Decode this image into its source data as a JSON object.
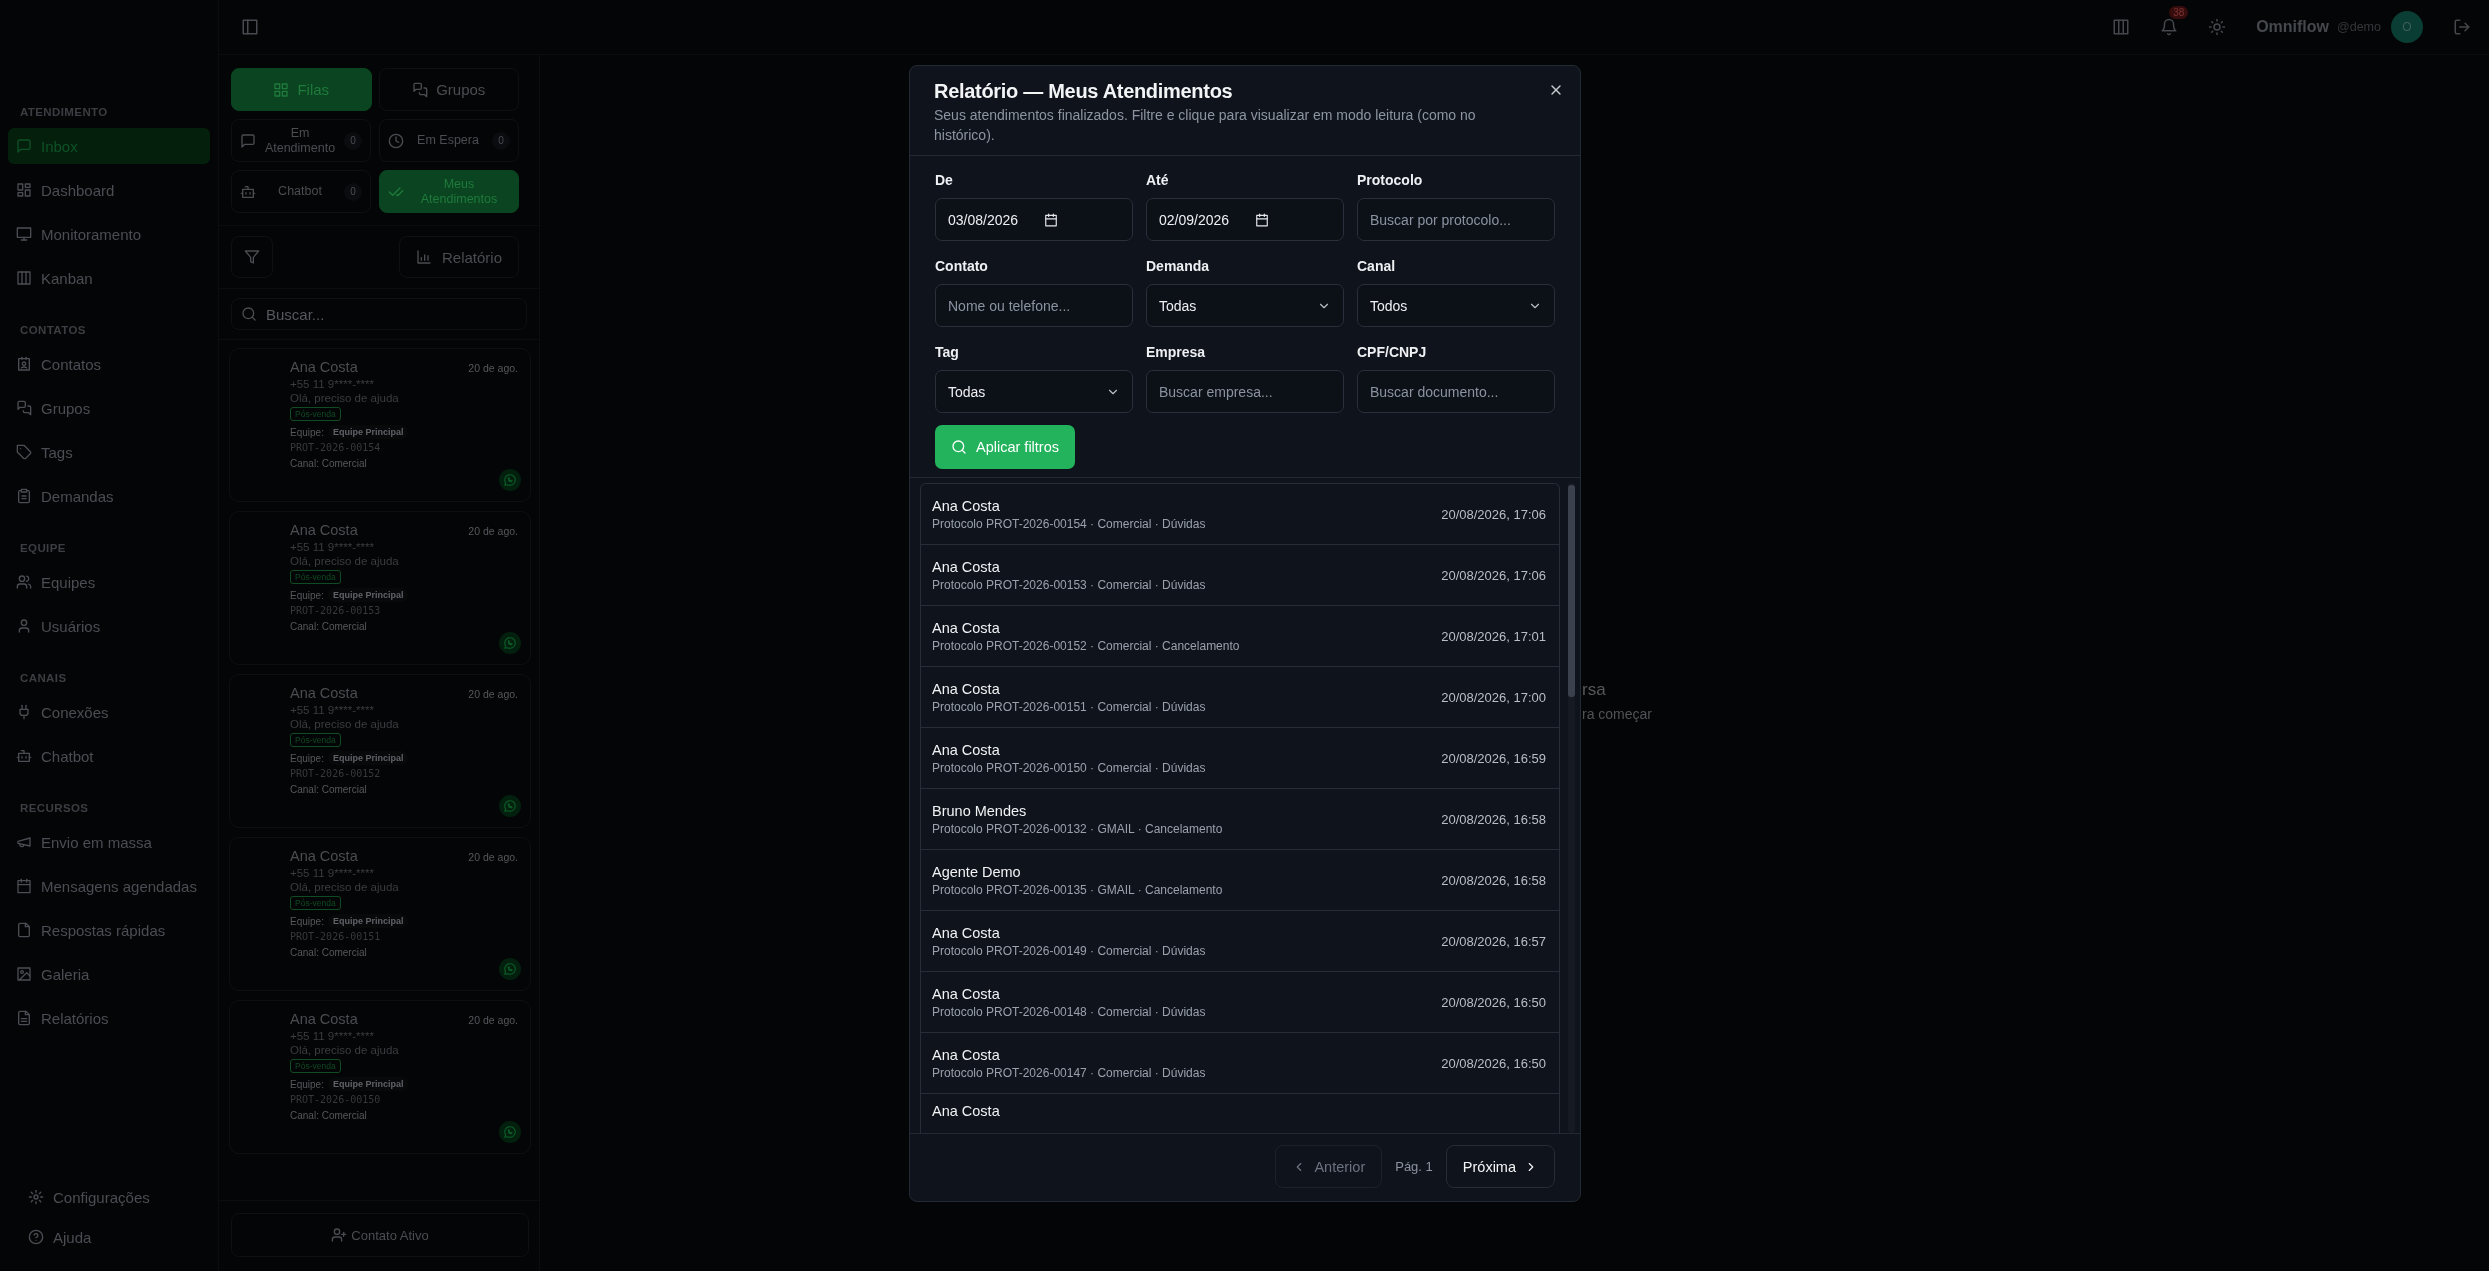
{
  "sidebar": {
    "sections": [
      {
        "title": "ATENDIMENTO",
        "items": [
          {
            "label": "Inbox",
            "selected": true
          },
          {
            "label": "Dashboard",
            "selected": false
          },
          {
            "label": "Monitoramento",
            "selected": false
          },
          {
            "label": "Kanban",
            "selected": false
          }
        ]
      },
      {
        "title": "CONTATOS",
        "items": [
          {
            "label": "Contatos",
            "selected": false
          },
          {
            "label": "Grupos",
            "selected": false
          },
          {
            "label": "Tags",
            "selected": false
          },
          {
            "label": "Demandas",
            "selected": false
          }
        ]
      },
      {
        "title": "EQUIPE",
        "items": [
          {
            "label": "Equipes",
            "selected": false
          },
          {
            "label": "Usuários",
            "selected": false
          }
        ]
      },
      {
        "title": "CANAIS",
        "items": [
          {
            "label": "Conexões",
            "selected": false
          },
          {
            "label": "Chatbot",
            "selected": false
          }
        ]
      },
      {
        "title": "RECURSOS",
        "items": [
          {
            "label": "Envio em massa",
            "selected": false
          },
          {
            "label": "Mensagens agendadas",
            "selected": false
          },
          {
            "label": "Respostas rápidas",
            "selected": false
          },
          {
            "label": "Galeria",
            "selected": false
          },
          {
            "label": "Relatórios",
            "selected": false
          }
        ]
      }
    ],
    "footer_items": [
      "Configurações",
      "Ajuda"
    ]
  },
  "header": {
    "notification_count": "38",
    "brand": "Omniflow",
    "username": "@demo",
    "avatar_initial": "O"
  },
  "inbox": {
    "tabs": [
      {
        "label": "Filas",
        "selected": true
      },
      {
        "label": "Grupos",
        "selected": false
      }
    ],
    "queues": [
      {
        "label": "Em Atendimento",
        "count": "0",
        "selected": false
      },
      {
        "label": "Em Espera",
        "count": "0",
        "selected": false
      },
      {
        "label": "Chatbot",
        "count": "0",
        "selected": false
      },
      {
        "label": "Meus Atendimentos",
        "selected": true
      }
    ],
    "report_button": "Relatório",
    "search": {
      "placeholder": "Buscar..."
    },
    "cards": [
      {
        "name": "Ana Costa",
        "date": "20 de ago.",
        "phone": "+55 11 9****-****",
        "message": "Olá, preciso de ajuda",
        "tag": "Pós-venda",
        "team_label": "Equipe:",
        "team": "Equipe Principal",
        "protocol": "PROT-2026-00154",
        "channel": "Canal: Comercial"
      },
      {
        "name": "Ana Costa",
        "date": "20 de ago.",
        "phone": "+55 11 9****-****",
        "message": "Olá, preciso de ajuda",
        "tag": "Pós-venda",
        "team_label": "Equipe:",
        "team": "Equipe Principal",
        "protocol": "PROT-2026-00153",
        "channel": "Canal: Comercial"
      },
      {
        "name": "Ana Costa",
        "date": "20 de ago.",
        "phone": "+55 11 9****-****",
        "message": "Olá, preciso de ajuda",
        "tag": "Pós-venda",
        "team_label": "Equipe:",
        "team": "Equipe Principal",
        "protocol": "PROT-2026-00152",
        "channel": "Canal: Comercial"
      },
      {
        "name": "Ana Costa",
        "date": "20 de ago.",
        "phone": "+55 11 9****-****",
        "message": "Olá, preciso de ajuda",
        "tag": "Pós-venda",
        "team_label": "Equipe:",
        "team": "Equipe Principal",
        "protocol": "PROT-2026-00151",
        "channel": "Canal: Comercial"
      },
      {
        "name": "Ana Costa",
        "date": "20 de ago.",
        "phone": "+55 11 9****-****",
        "message": "Olá, preciso de ajuda",
        "tag": "Pós-venda",
        "team_label": "Equipe:",
        "team": "Equipe Principal",
        "protocol": "PROT-2026-00150",
        "channel": "Canal: Comercial"
      }
    ],
    "footer_button": "Contato Ativo"
  },
  "main": {
    "empty_state_lines": [
      "rsa",
      "ra começar"
    ]
  },
  "modal": {
    "title": "Relatório — Meus Atendimentos",
    "subtitle": "Seus atendimentos finalizados. Filtre e clique para visualizar em modo leitura (como no histórico).",
    "filters": [
      {
        "label": "De",
        "kind": "date",
        "value": "03/08/2026"
      },
      {
        "label": "Até",
        "kind": "date",
        "value": "02/09/2026"
      },
      {
        "label": "Protocolo",
        "kind": "text",
        "placeholder": "Buscar por protocolo..."
      },
      {
        "label": "Contato",
        "kind": "text",
        "placeholder": "Nome ou telefone..."
      },
      {
        "label": "Demanda",
        "kind": "select",
        "value": "Todas"
      },
      {
        "label": "Canal",
        "kind": "select",
        "value": "Todos"
      },
      {
        "label": "Tag",
        "kind": "select",
        "value": "Todas"
      },
      {
        "label": "Empresa",
        "kind": "text",
        "placeholder": "Buscar empresa..."
      },
      {
        "label": "CPF/CNPJ",
        "kind": "text",
        "placeholder": "Buscar documento..."
      }
    ],
    "apply_button": "Aplicar filtros",
    "results": [
      {
        "name": "Ana Costa",
        "details": "Protocolo PROT-2026-00154 · Comercial · Dúvidas",
        "time": "20/08/2026, 17:06"
      },
      {
        "name": "Ana Costa",
        "details": "Protocolo PROT-2026-00153 · Comercial · Dúvidas",
        "time": "20/08/2026, 17:06"
      },
      {
        "name": "Ana Costa",
        "details": "Protocolo PROT-2026-00152 · Comercial · Cancelamento",
        "time": "20/08/2026, 17:01"
      },
      {
        "name": "Ana Costa",
        "details": "Protocolo PROT-2026-00151 · Comercial · Dúvidas",
        "time": "20/08/2026, 17:00"
      },
      {
        "name": "Ana Costa",
        "details": "Protocolo PROT-2026-00150 · Comercial · Dúvidas",
        "time": "20/08/2026, 16:59"
      },
      {
        "name": "Bruno Mendes",
        "details": "Protocolo PROT-2026-00132 · GMAIL · Cancelamento",
        "time": "20/08/2026, 16:58"
      },
      {
        "name": "Agente Demo",
        "details": "Protocolo PROT-2026-00135 · GMAIL · Cancelamento",
        "time": "20/08/2026, 16:58"
      },
      {
        "name": "Ana Costa",
        "details": "Protocolo PROT-2026-00149 · Comercial · Dúvidas",
        "time": "20/08/2026, 16:57"
      },
      {
        "name": "Ana Costa",
        "details": "Protocolo PROT-2026-00148 · Comercial · Dúvidas",
        "time": "20/08/2026, 16:50"
      },
      {
        "name": "Ana Costa",
        "details": "Protocolo PROT-2026-00147 · Comercial · Dúvidas",
        "time": "20/08/2026, 16:50"
      },
      {
        "name": "Ana Costa"
      }
    ],
    "pagination": {
      "previous": {
        "label": "Anterior",
        "disabled": true
      },
      "page": "Pág. 1",
      "next": {
        "label": "Próxima",
        "disabled": false
      }
    }
  }
}
